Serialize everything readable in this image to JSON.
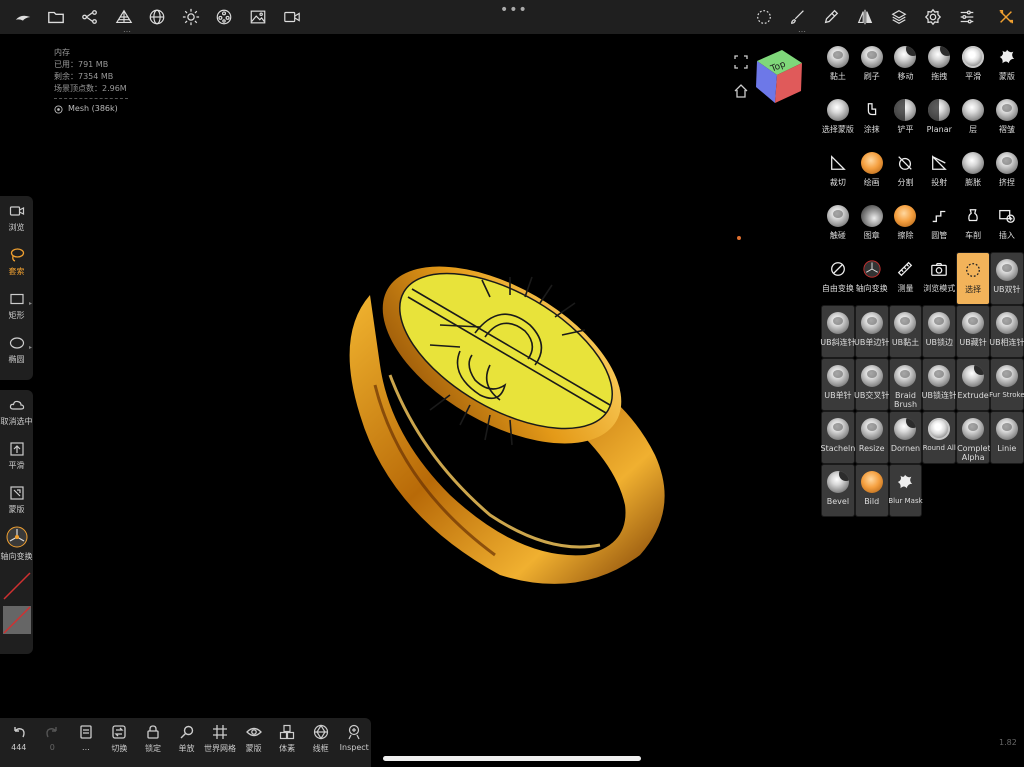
{
  "topbar": {
    "left_icons": [
      "nomad-logo-icon",
      "folder-icon",
      "scene-graph-icon",
      "mesh-icon",
      "sphere-grid-icon",
      "sun-icon",
      "material-icon",
      "image-icon",
      "camera-icon"
    ],
    "right_icons": [
      "lasso-select-icon",
      "brush-icon",
      "dropper-icon",
      "symmetry-icon",
      "layers-icon",
      "settings-icon",
      "sliders-icon",
      "tools-icon"
    ]
  },
  "info": {
    "title": "内存",
    "used": "已用：791 MB",
    "free": "剩余：7354 MB",
    "vertices": "场景顶点数：2.96M",
    "mesh": "Mesh (386k)"
  },
  "left_tools": [
    {
      "name": "camera",
      "label": "浏览"
    },
    {
      "name": "lasso",
      "label": "套索"
    },
    {
      "name": "rectangle",
      "label": "矩形"
    },
    {
      "name": "ellipse",
      "label": "椭圆"
    }
  ],
  "left_actions": [
    {
      "name": "deselect",
      "label": "取消选中"
    },
    {
      "name": "smooth",
      "label": "平滑"
    },
    {
      "name": "mask",
      "label": "蒙版"
    },
    {
      "name": "axis-transform",
      "label": "轴向变换"
    }
  ],
  "view_cube": {
    "label": "Top"
  },
  "brushes": [
    {
      "label": "黏土",
      "style": "dent",
      "boxed": false
    },
    {
      "label": "刷子",
      "style": "dent",
      "boxed": false
    },
    {
      "label": "移动",
      "style": "cut",
      "boxed": false
    },
    {
      "label": "拖拽",
      "style": "cut",
      "boxed": false
    },
    {
      "label": "平滑",
      "style": "fuzzy",
      "boxed": false
    },
    {
      "label": "蒙版",
      "style": "glyph-splat",
      "boxed": false
    },
    {
      "label": "选择蒙版",
      "style": "plain",
      "boxed": false
    },
    {
      "label": "涂抹",
      "style": "glyph-smudge",
      "boxed": false
    },
    {
      "label": "铲平",
      "style": "half",
      "boxed": false
    },
    {
      "label": "Planar",
      "style": "half",
      "boxed": false
    },
    {
      "label": "层",
      "style": "plain",
      "boxed": false
    },
    {
      "label": "褶皱",
      "style": "dent",
      "boxed": false
    },
    {
      "label": "裁切",
      "style": "glyph-trim",
      "boxed": false
    },
    {
      "label": "绘画",
      "style": "orange",
      "boxed": false
    },
    {
      "label": "分割",
      "style": "glyph-split",
      "boxed": false
    },
    {
      "label": "投射",
      "style": "glyph-project",
      "boxed": false
    },
    {
      "label": "膨胀",
      "style": "plain",
      "boxed": false
    },
    {
      "label": "挤捏",
      "style": "dent",
      "boxed": false
    },
    {
      "label": "触碰",
      "style": "dent",
      "boxed": false
    },
    {
      "label": "图章",
      "style": "dark",
      "boxed": false
    },
    {
      "label": "擦除",
      "style": "orange",
      "boxed": false
    },
    {
      "label": "圆管",
      "style": "glyph-tube",
      "boxed": false
    },
    {
      "label": "车削",
      "style": "glyph-lathe",
      "boxed": false
    },
    {
      "label": "插入",
      "style": "glyph-insert",
      "boxed": false
    },
    {
      "label": "自由变换",
      "style": "glyph-nosel",
      "boxed": false
    },
    {
      "label": "轴向变换",
      "style": "glyph-gizmo",
      "boxed": false
    },
    {
      "label": "测量",
      "style": "glyph-ruler",
      "boxed": false
    },
    {
      "label": "浏览模式",
      "style": "glyph-camera",
      "boxed": false
    },
    {
      "label": "选择",
      "style": "glyph-select",
      "boxed": true,
      "active": true
    },
    {
      "label": "UB双针",
      "style": "dent",
      "boxed": true
    },
    {
      "label": "UB斜连针",
      "style": "dent",
      "boxed": true
    },
    {
      "label": "UB单边针",
      "style": "dent",
      "boxed": true
    },
    {
      "label": "UB黏土",
      "style": "dent",
      "boxed": true
    },
    {
      "label": "UB锁边",
      "style": "dent",
      "boxed": true
    },
    {
      "label": "UB藏针",
      "style": "dent",
      "boxed": true
    },
    {
      "label": "UB相连针",
      "style": "dent",
      "boxed": true
    },
    {
      "label": "UB单针",
      "style": "dent",
      "boxed": true
    },
    {
      "label": "UB交叉针",
      "style": "dent",
      "boxed": true
    },
    {
      "label": "Braid Brush",
      "style": "dent",
      "boxed": true,
      "wrap": true
    },
    {
      "label": "UB锁连针",
      "style": "dent",
      "boxed": true
    },
    {
      "label": "Extrude",
      "style": "cut",
      "boxed": true
    },
    {
      "label": "Fur Stroke",
      "style": "dent",
      "boxed": true,
      "small": true
    },
    {
      "label": "Stacheln",
      "style": "dent",
      "boxed": true
    },
    {
      "label": "Resize",
      "style": "dent",
      "boxed": true
    },
    {
      "label": "Dornen",
      "style": "cut",
      "boxed": true
    },
    {
      "label": "Round All",
      "style": "fuzzy",
      "boxed": true,
      "small": true
    },
    {
      "label": "Complete Alpha",
      "style": "dent",
      "boxed": true,
      "wrap": true
    },
    {
      "label": "Linie",
      "style": "dent",
      "boxed": true
    },
    {
      "label": "Bevel",
      "style": "cut",
      "boxed": true
    },
    {
      "label": "Bild",
      "style": "orange",
      "boxed": true
    },
    {
      "label": "Blur Mask",
      "style": "glyph-splat",
      "boxed": true,
      "small": true
    }
  ],
  "bottom_tools": [
    {
      "name": "undo",
      "label": "444",
      "dim": false
    },
    {
      "name": "redo",
      "label": "0",
      "dim": true
    },
    {
      "name": "menu",
      "label": "...",
      "dim": false
    },
    {
      "name": "toggle",
      "label": "切换",
      "dim": false
    },
    {
      "name": "lock",
      "label": "锁定",
      "dim": false
    },
    {
      "name": "solo",
      "label": "单放",
      "dim": false
    },
    {
      "name": "world-grid",
      "label": "世界网格",
      "dim": false
    },
    {
      "name": "mask",
      "label": "蒙版",
      "dim": false
    },
    {
      "name": "voxel",
      "label": "体素",
      "dim": false
    },
    {
      "name": "wireframe",
      "label": "线框",
      "dim": false
    },
    {
      "name": "inspect",
      "label": "Inspect",
      "dim": false
    }
  ],
  "version": "1.82",
  "colors": {
    "accent": "#f2b35a",
    "panel": "#1f1f1f",
    "gold": "#e3a326",
    "engraving": "#e8e33a"
  }
}
